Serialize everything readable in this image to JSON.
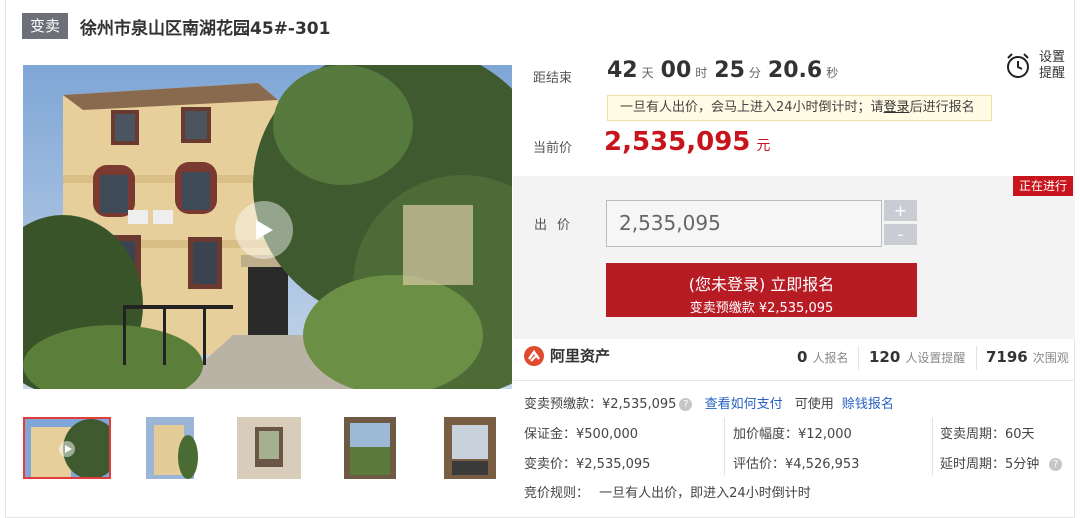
{
  "header": {
    "tag": "变卖",
    "title": "徐州市泉山区南湖花园45#-301"
  },
  "countdown": {
    "label": "距结束",
    "days": "42",
    "days_unit": "天",
    "hours": "00",
    "hours_unit": "时",
    "minutes": "25",
    "minutes_unit": "分",
    "seconds": "20.6",
    "seconds_unit": "秒"
  },
  "remind": {
    "label": "设置提醒",
    "icon": "alarm-clock-icon"
  },
  "notice": {
    "prefix": "一旦有人出价，会马上进入24小时倒计时；请",
    "link": "登录",
    "suffix": "后进行报名"
  },
  "current_price": {
    "label": "当前价",
    "value": "2,535,095",
    "unit": "元",
    "color": "#c8151d"
  },
  "bid": {
    "status_badge": "正在进行",
    "label": "出价",
    "input_value": "2,535,095",
    "plus": "+",
    "minus": "-",
    "button_line1": "(您未登录) 立即报名",
    "button_line2": "变卖预缴款 ¥2,535,095"
  },
  "platform": {
    "name": "阿里资产",
    "icon": "ali-assets-logo-icon"
  },
  "stats": {
    "signups": "0",
    "signups_unit": "人报名",
    "reminders": "120",
    "reminders_unit": "人设置提醒",
    "views": "7196",
    "views_unit": "次围观"
  },
  "details": {
    "deposit_row": {
      "label": "变卖预缴款：¥2,535,095",
      "pay_link": "查看如何支付",
      "usable": "可使用",
      "earn_link": "赊钱报名"
    },
    "guarantee": "保证金：¥500,000",
    "increment": "加价幅度：¥12,000",
    "cycle": "变卖周期：60天",
    "sale_price": "变卖价：¥2,535,095",
    "appraisal": "评估价：¥4,526,953",
    "delay": "延时周期：5分钟",
    "rule_label": "竞价规则：",
    "rule_text": "一旦有人出价，即进入24小时倒计时"
  },
  "colors": {
    "accent": "#c8151d",
    "button": "#b71c25",
    "link": "#2661c4",
    "tag": "#6d7078"
  }
}
